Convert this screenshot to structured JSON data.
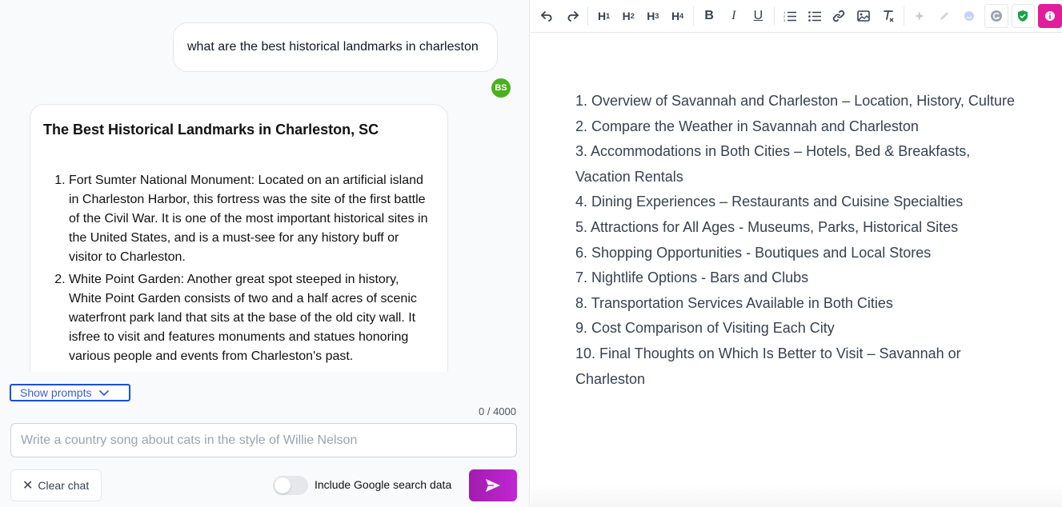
{
  "chat": {
    "user_message": "what are the best historical landmarks in charleston",
    "avatar_initials": "BS",
    "assistant": {
      "title": "The Best Historical Landmarks in Charleston, SC",
      "items": [
        "Fort Sumter National Monument: Located on an artificial island in Charleston Harbor, this fortress was the site of the first battle of the Civil War. It is one of the most important historical sites in the United States, and is a must-see for any history buff or visitor to Charleston.",
        "White Point Garden: Another great spot steeped in history, White Point Garden consists of two and a half acres of scenic waterfront park land that sits at the base of the old city wall. It isfree to visit and features monuments and statues honoring various people and events from Charleston's past."
      ]
    },
    "show_prompts_label": "Show prompts",
    "char_count": "0 / 4000",
    "input_placeholder": "Write a country song about cats in the style of Willie Nelson",
    "input_value": "",
    "clear_label": "Clear chat",
    "toggle_label": "Include Google search data",
    "toggle_on": false
  },
  "editor": {
    "toolbar": {
      "h1": "H",
      "h1_sub": "1",
      "h2": "H",
      "h2_sub": "2",
      "h3": "H",
      "h3_sub": "3",
      "h4": "H",
      "h4_sub": "4",
      "bold": "B",
      "italic": "I",
      "underline": "U"
    },
    "lines": [
      "1. Overview of Savannah and Charleston – Location, History, Culture",
      "2. Compare the Weather in Savannah and Charleston",
      "3. Accommodations in Both Cities – Hotels, Bed & Breakfasts, Vacation Rentals",
      "4. Dining Experiences – Restaurants and Cuisine Specialties",
      "5. Attractions for All Ages - Museums, Parks, Historical Sites",
      "6. Shopping Opportunities - Boutiques and Local Stores",
      "7. Nightlife Options - Bars and Clubs",
      "8. Transportation Services Available in Both Cities",
      "9. Cost Comparison of Visiting Each City",
      "10. Final Thoughts on Which Is Better to Visit – Savannah or Charleston"
    ]
  },
  "colors": {
    "send_button": "#c026d3",
    "avatar": "#4caf20",
    "show_prompts_border": "#1d4ed8"
  }
}
